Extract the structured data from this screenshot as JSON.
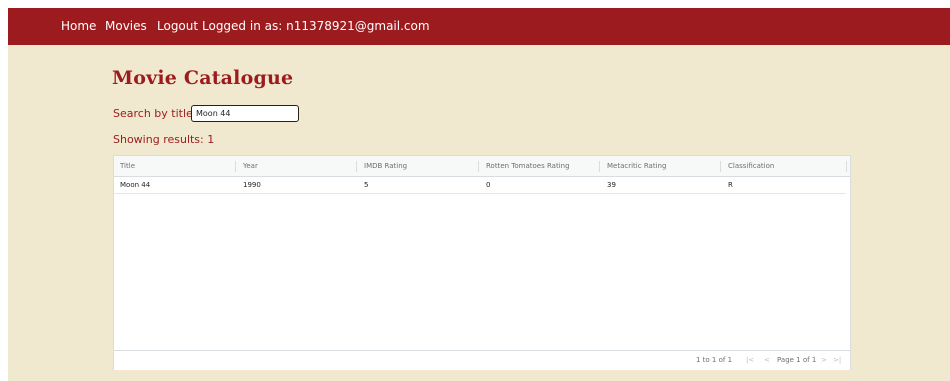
{
  "nav": {
    "home": "Home",
    "movies": "Movies",
    "logout": "Logout",
    "logged_in": "Logged in as: n11378921@gmail.com"
  },
  "page": {
    "title": "Movie Catalogue",
    "search_label": "Search by title:",
    "search_value": "Moon 44",
    "results_text": "Showing results: 1"
  },
  "table": {
    "columns": [
      "Title",
      "Year",
      "IMDB Rating",
      "Rotten Tomatoes Rating",
      "Metacritic Rating",
      "Classification"
    ],
    "rows": [
      [
        "Moon 44",
        "1990",
        "5",
        "0",
        "39",
        "R"
      ]
    ]
  },
  "pagination": {
    "range": "1 to 1 of 1",
    "first_icon": "first-page-icon",
    "prev_icon": "previous-page-icon",
    "page_info": "Page 1 of 1",
    "next_icon": "next-page-icon",
    "last_icon": "last-page-icon"
  },
  "colors": {
    "brand": "#9c1b1e",
    "background": "#f0e8cf"
  }
}
